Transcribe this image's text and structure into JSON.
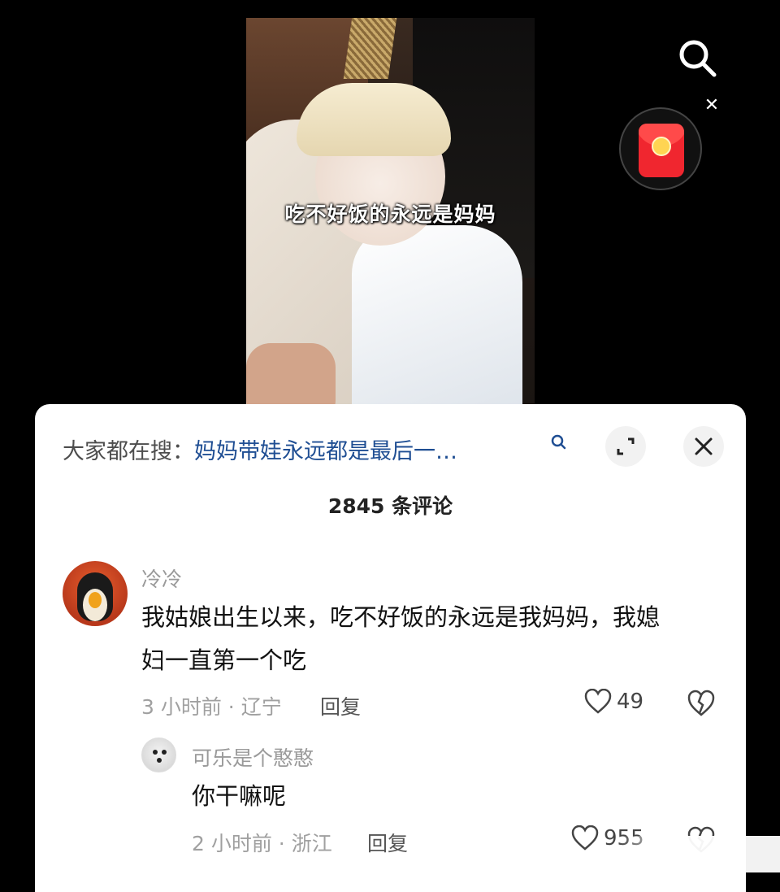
{
  "video": {
    "caption": "吃不好饭的永远是妈妈"
  },
  "panel": {
    "hot_search_prefix": "大家都在搜：",
    "hot_search_term": "妈妈带娃永远都是最后一…",
    "comment_count": "2845 条评论"
  },
  "comments": [
    {
      "username": "冷冷",
      "text_line1": "我姑娘出生以来，吃不好饭的永远是我妈妈，我媳",
      "text_line2": "妇一直第一个吃",
      "meta": "3 小时前 · 辽宁",
      "reply_label": "回复",
      "likes": "49"
    },
    {
      "username": "可乐是个憨憨",
      "text": "你干嘛呢",
      "meta": "2 小时前 · 浙江",
      "reply_label": "回复",
      "likes": "955"
    }
  ],
  "colors": {
    "hot_term": "#1f4e93",
    "red_packet": "#f0262f"
  },
  "icons": [
    "search-icon",
    "red-packet-icon",
    "close-icon",
    "expand-icon",
    "heart-icon",
    "broken-heart-icon"
  ]
}
